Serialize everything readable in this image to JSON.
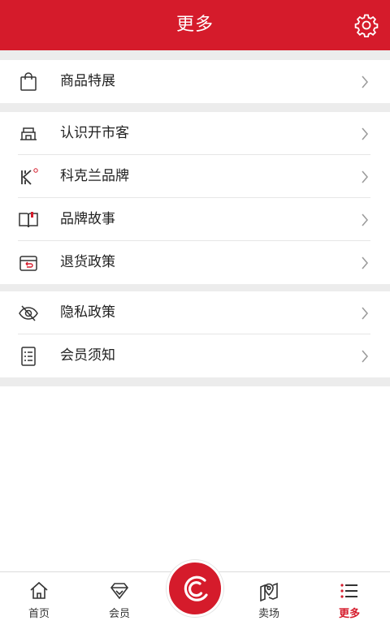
{
  "header": {
    "title": "更多",
    "settings_icon": "gear-icon"
  },
  "menu": {
    "group1": [
      {
        "label": "商品特展",
        "icon": "shopping-bag-icon"
      }
    ],
    "group2": [
      {
        "label": "认识开市客",
        "icon": "storefront-icon"
      },
      {
        "label": "科克兰品牌",
        "icon": "kirkland-logo-icon"
      },
      {
        "label": "品牌故事",
        "icon": "open-book-icon"
      },
      {
        "label": "退货政策",
        "icon": "return-box-icon"
      }
    ],
    "group3": [
      {
        "label": "隐私政策",
        "icon": "eye-slash-icon"
      },
      {
        "label": "会员须知",
        "icon": "checklist-icon"
      }
    ]
  },
  "tabbar": {
    "tabs": [
      {
        "label": "首页",
        "icon": "home-icon"
      },
      {
        "label": "会员",
        "icon": "diamond-icon"
      },
      {
        "label": "卖场",
        "icon": "map-pin-icon"
      },
      {
        "label": "更多",
        "icon": "list-icon",
        "active": true
      }
    ],
    "center_icon": "costco-logo-icon"
  },
  "colors": {
    "brand": "#d51b2b",
    "divider": "#ececec"
  }
}
